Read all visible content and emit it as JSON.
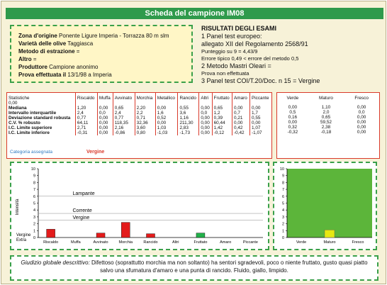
{
  "header": {
    "title": "Scheda del campione IM08"
  },
  "sample": {
    "zona_label": "Zona d'origine",
    "zona_value": "Ponente Ligure Imperia - Torrazza 80 m slm",
    "varieta_label": "Varietà delle olive",
    "varieta_value": "Taggiasca",
    "metodo_label": "Metodo di estrazione",
    "metodo_value": "=",
    "altro_label": "Altro",
    "altro_value": "=",
    "produttore_label": "Produttore",
    "produttore_value": "Campione anonimo",
    "prova_label": "Prova effettuata il",
    "prova_value": "13/1/98 a Imperia"
  },
  "results": {
    "title": "RISULTATI DEGLI ESAMI",
    "p1": "1 Panel test europeo:",
    "p1b": "allegato XII del Regolamento 2568/91",
    "p1c": "Punteggio su 9 = 4,43/9",
    "p1d": "Errore tipico 0,49 < errore del metodo 0,5",
    "p2": "2 Metodo Mastri Oleari =",
    "p2b": "Prova non effettuata",
    "p3": "3 Panel test COI/T.20/Doc. n 15 = Vergine"
  },
  "stats": {
    "head": [
      "Statistiche\n0,00",
      "Riscaldo",
      "Muffa",
      "Avvinato",
      "Morchia",
      "Metallico",
      "Rancido",
      "Altri",
      "Fruttato",
      "Amaro",
      "Piccante"
    ],
    "rows": [
      {
        "label": "Mediana",
        "vals": [
          "1,20",
          "0,00",
          "0,65",
          "2,20",
          "0,00",
          "0,55",
          "0,00",
          "0,65",
          "0,00",
          "0,00"
        ]
      },
      {
        "label": "Intervallo interquartile",
        "vals": [
          "2,4",
          "0,0",
          "2,4",
          "2,2",
          "1,6",
          "3,6",
          "0,0",
          "1,2",
          "0,7",
          "1,7"
        ]
      },
      {
        "label": "Deviazione standard robusta",
        "vals": [
          "0,77",
          "0,00",
          "0,77",
          "0,71",
          "0,52",
          "1,16",
          "0,00",
          "0,39",
          "0,21",
          "0,55"
        ]
      },
      {
        "label": "C.V. % robusto",
        "vals": [
          "64,11",
          "0,00",
          "118,35",
          "32,36",
          "0,00",
          "211,30",
          "0,00",
          "60,44",
          "0,00",
          "0,00"
        ]
      },
      {
        "label": "I.C. Limite superiore",
        "vals": [
          "2,71",
          "0,00",
          "2,16",
          "3,60",
          "1,03",
          "2,83",
          "0,00",
          "1,42",
          "0,42",
          "1,07"
        ]
      },
      {
        "label": "I.C. Limite inferiore",
        "vals": [
          "-0,31",
          "0,00",
          "-0,86",
          "0,80",
          "-1,03",
          "-1,73",
          "0,00",
          "-0,12",
          "-0,42",
          "-1,07"
        ]
      }
    ],
    "categoria_label": "Categoria assegnata",
    "categoria_value": "Vergine"
  },
  "fresh": {
    "head": [
      "Verde",
      "Maturo",
      "Fresco"
    ],
    "rows": [
      [
        "0,00",
        "1,10",
        "0,00"
      ],
      [
        "0,5",
        "2,0",
        "0,0"
      ],
      [
        "0,16",
        "0,65",
        "0,00"
      ],
      [
        "0,00",
        "59,52",
        "0,00"
      ],
      [
        "0,32",
        "2,38",
        "0,00"
      ],
      [
        "-0,32",
        "-0,18",
        "0,00"
      ]
    ]
  },
  "chart_data": [
    {
      "type": "bar",
      "categories": [
        "Riscaldo",
        "Muffa",
        "Avvinato",
        "Morchia",
        "Rancido",
        "Altri",
        "Fruttato",
        "Amaro",
        "Piccante"
      ],
      "values": [
        1.2,
        0.0,
        0.65,
        2.2,
        0.55,
        0.0,
        0.65,
        0.0,
        0.0
      ],
      "colors": [
        "#e31b1b",
        "#e31b1b",
        "#e31b1b",
        "#e31b1b",
        "#e31b1b",
        "#e31b1b",
        "#22b04a",
        "#22b04a",
        "#22b04a"
      ],
      "ylim": [
        0,
        10
      ],
      "yticks": [
        "0",
        "1",
        "2",
        "3",
        "4",
        "5",
        "6",
        "7",
        "8",
        "9",
        "10"
      ],
      "ylabel": "Intensità",
      "bands": [
        {
          "label": "Lampante",
          "y": 6.0
        },
        {
          "label": "Corrente",
          "y": 3.5
        },
        {
          "label": "Vergine",
          "y": 2.5
        }
      ],
      "bottom_labels": [
        "Vergine",
        "Extra"
      ]
    },
    {
      "type": "bar",
      "categories": [
        "Verde",
        "Maturo",
        "Fresco"
      ],
      "values": [
        0.0,
        1.1,
        0.0
      ],
      "colors": [
        "#e7e812",
        "#e7e812",
        "#e7e812"
      ],
      "ylim": [
        0,
        10
      ],
      "yticks": [
        "0",
        "1",
        "2",
        "3",
        "4",
        "5",
        "6",
        "7",
        "8",
        "9",
        "10"
      ],
      "background": "#5cb53a"
    }
  ],
  "footer": {
    "label": "Giudizio globale descrittivo:",
    "text": "Difettoso (soprattutto morchia ma non soltanto) ha sentori sgradevoli, poco o niente fruttato, gusto quasi piatto salvo una sfumatura d'amaro e una punta di rancido. Fluido, giallo, limpido."
  },
  "colors": {
    "accent_green": "#2f9a4c",
    "accent_red": "#d93a2b",
    "panel_yellow": "#fff6c6",
    "paper": "#f7f2d8"
  }
}
